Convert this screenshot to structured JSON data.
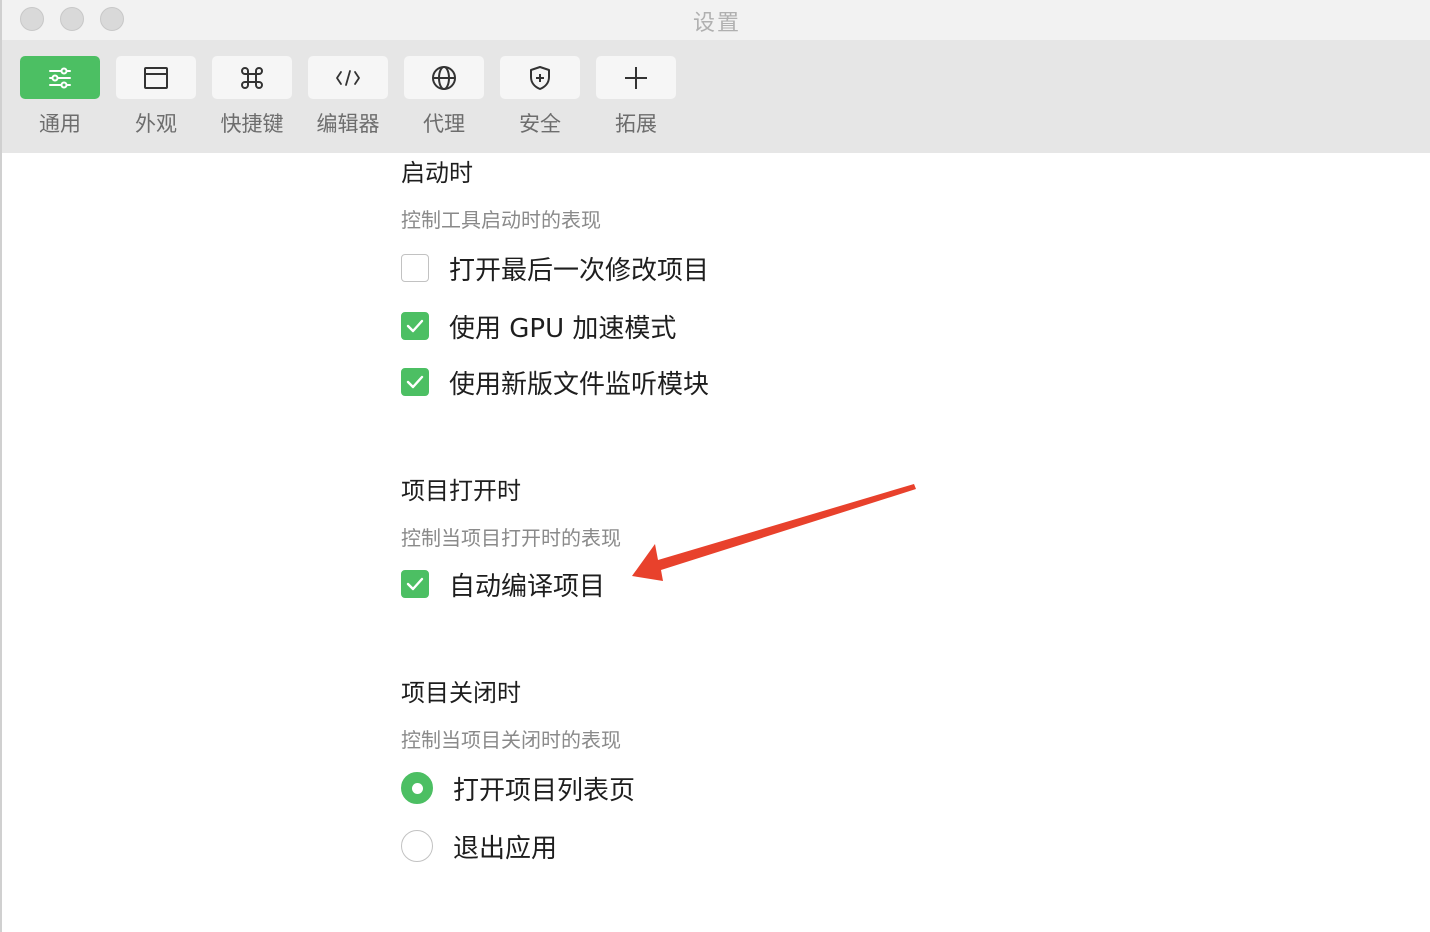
{
  "window": {
    "title": "设置"
  },
  "toolbar": {
    "items": [
      {
        "label": "通用",
        "icon": "sliders-icon",
        "active": true
      },
      {
        "label": "外观",
        "icon": "window-icon",
        "active": false
      },
      {
        "label": "快捷键",
        "icon": "command-key-icon",
        "active": false
      },
      {
        "label": "编辑器",
        "icon": "code-icon",
        "active": false
      },
      {
        "label": "代理",
        "icon": "globe-icon",
        "active": false
      },
      {
        "label": "安全",
        "icon": "shield-icon",
        "active": false
      },
      {
        "label": "拓展",
        "icon": "plus-icon",
        "active": false
      }
    ]
  },
  "sections": {
    "startup": {
      "title": "启动时",
      "desc": "控制工具启动时的表现",
      "options": [
        {
          "label": "打开最后一次修改项目",
          "checked": false
        },
        {
          "label": "使用 GPU 加速模式",
          "checked": true
        },
        {
          "label": "使用新版文件监听模块",
          "checked": true
        }
      ]
    },
    "project_open": {
      "title": "项目打开时",
      "desc": "控制当项目打开时的表现",
      "options": [
        {
          "label": "自动编译项目",
          "checked": true
        }
      ]
    },
    "project_close": {
      "title": "项目关闭时",
      "desc": "控制当项目关闭时的表现",
      "options": [
        {
          "label": "打开项目列表页",
          "selected": true
        },
        {
          "label": "退出应用",
          "selected": false
        }
      ]
    }
  },
  "colors": {
    "accent": "#4cbf63",
    "annotation_arrow": "#e8412c",
    "toolbar_bg": "#e6e6e6"
  }
}
